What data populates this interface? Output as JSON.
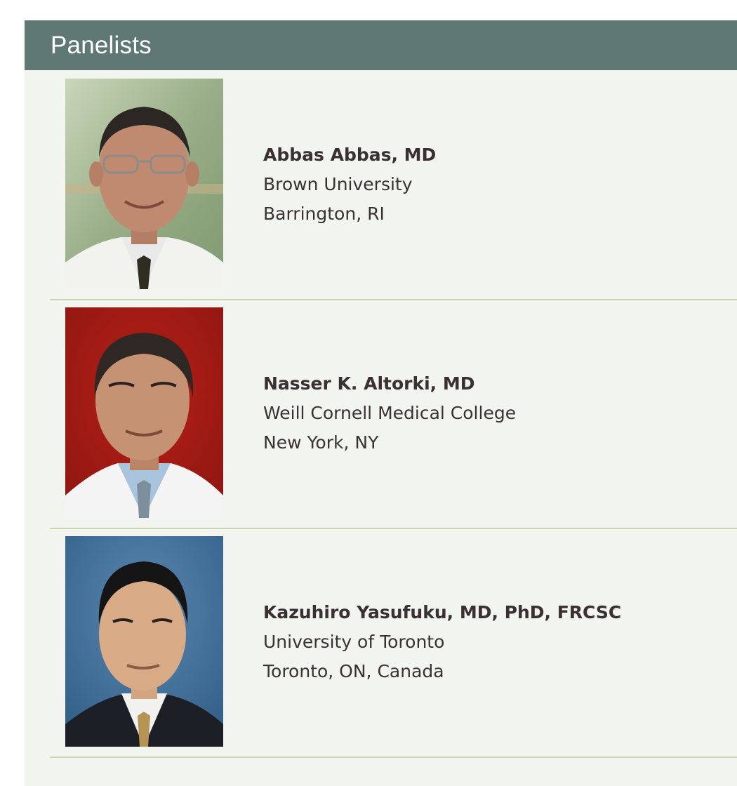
{
  "section": {
    "title": "Panelists"
  },
  "panelists": [
    {
      "name": "Abbas Abbas, MD",
      "institution": "Brown University",
      "location": "Barrington, RI",
      "photo_icon": "headshot-photo",
      "photo_bg": "#a7b79a"
    },
    {
      "name": "Nasser K. Altorki, MD",
      "institution": "Weill Cornell Medical College",
      "location": "New York, NY",
      "photo_icon": "headshot-photo",
      "photo_bg": "#a11a14"
    },
    {
      "name": "Kazuhiro Yasufuku, MD, PhD, FRCSC",
      "institution": "University of Toronto",
      "location": "Toronto, ON, Canada",
      "photo_icon": "headshot-photo",
      "photo_bg": "#3f6e98"
    }
  ],
  "colors": {
    "header_bg": "#5f7873",
    "panel_bg": "#f1f4ef",
    "divider": "#c9d6ad",
    "text": "#3a3133"
  }
}
